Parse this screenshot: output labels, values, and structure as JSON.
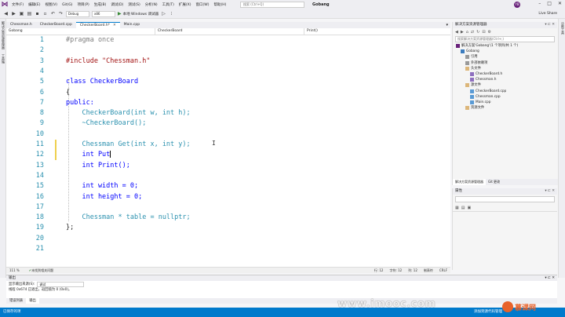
{
  "menubar": {
    "items": [
      "文件(F)",
      "编辑(E)",
      "视图(V)",
      "Git(G)",
      "项目(P)",
      "生成(B)",
      "调试(D)",
      "测试(S)",
      "分析(N)",
      "工具(T)",
      "扩展(X)",
      "窗口(W)",
      "帮助(H)"
    ],
    "search_placeholder": "搜索 (Ctrl+Q)",
    "project_name": "Gobang",
    "avatar": "YB"
  },
  "toolbar": {
    "config": "Debug",
    "platform": "x86",
    "run_label": "本地 Windows 调试器",
    "liveshare": "Live Share"
  },
  "left_strip": [
    "解决方案资源管理器",
    "工具箱"
  ],
  "tabs": [
    {
      "label": "Chessman.h",
      "active": false
    },
    {
      "label": "CheckerBoard.cpp",
      "active": false
    },
    {
      "label": "CheckerBoard.h*",
      "active": true
    },
    {
      "label": "Main.cpp",
      "active": false
    }
  ],
  "navbar": {
    "project": "Gobang",
    "scope": "CheckerBoard",
    "member": "Print()"
  },
  "code": {
    "lines": [
      {
        "n": "1",
        "text": "#pragma once"
      },
      {
        "n": "2",
        "text": ""
      },
      {
        "n": "3",
        "text": "#include \"Chessman.h\""
      },
      {
        "n": "4",
        "text": ""
      },
      {
        "n": "5",
        "text": "class CheckerBoard"
      },
      {
        "n": "6",
        "text": "{"
      },
      {
        "n": "7",
        "text": "public:"
      },
      {
        "n": "8",
        "text": "    CheckerBoard(int w, int h);"
      },
      {
        "n": "9",
        "text": "    ~CheckerBoard();"
      },
      {
        "n": "10",
        "text": ""
      },
      {
        "n": "11",
        "text": "    Chessman Get(int x, int y);"
      },
      {
        "n": "12",
        "text": "    int Put"
      },
      {
        "n": "13",
        "text": "    int Print();"
      },
      {
        "n": "14",
        "text": ""
      },
      {
        "n": "15",
        "text": "    int width = 0;"
      },
      {
        "n": "16",
        "text": "    int height = 0;"
      },
      {
        "n": "17",
        "text": ""
      },
      {
        "n": "18",
        "text": "    Chessman * table = nullptr;"
      },
      {
        "n": "19",
        "text": "};"
      },
      {
        "n": "20",
        "text": ""
      },
      {
        "n": "21",
        "text": ""
      }
    ]
  },
  "editor_status": {
    "zoom": "111 %",
    "issues": "未找到相关问题",
    "line": "行: 12",
    "char": "字符: 12",
    "col": "列: 12",
    "tabs": "制表符",
    "eol": "CRLF"
  },
  "solution_explorer": {
    "title": "解决方案资源管理器",
    "search_placeholder": "搜索解决方案资源管理器(Ctrl+;)",
    "items": [
      {
        "label": "解决方案'Gobang'(1 个项目/共 1 个)",
        "indent": 0,
        "icon": "sln"
      },
      {
        "label": "Gobang",
        "indent": 1,
        "icon": "proj"
      },
      {
        "label": "引用",
        "indent": 2,
        "icon": "ref"
      },
      {
        "label": "外部依赖项",
        "indent": 2,
        "icon": "ref"
      },
      {
        "label": "头文件",
        "indent": 2,
        "icon": "folder"
      },
      {
        "label": "CheckerBoard.h",
        "indent": 3,
        "icon": "h"
      },
      {
        "label": "Chessman.h",
        "indent": 3,
        "icon": "h"
      },
      {
        "label": "源文件",
        "indent": 2,
        "icon": "folder"
      },
      {
        "label": "CheckerBoard.cpp",
        "indent": 3,
        "icon": "cpp"
      },
      {
        "label": "Chessman.cpp",
        "indent": 3,
        "icon": "cpp"
      },
      {
        "label": "Main.cpp",
        "indent": 3,
        "icon": "cpp"
      },
      {
        "label": "资源文件",
        "indent": 2,
        "icon": "folder"
      }
    ],
    "tabs": [
      "解决方案资源管理器",
      "Git 更改"
    ]
  },
  "properties": {
    "title": "属性"
  },
  "right_strip": [
    "诊断工具"
  ],
  "output": {
    "title": "输出",
    "source_label": "显示输出来源(S):",
    "source_value": "调试",
    "text": "线程 0x674 已退出，返回值为 0 (0x0)。"
  },
  "bottom_tabs": [
    "错误列表",
    "输出"
  ],
  "statusbar": {
    "left": "已保存的项",
    "right": "添加到源代码管理"
  },
  "watermark": "www.imooc.com",
  "brand": "慕课网"
}
